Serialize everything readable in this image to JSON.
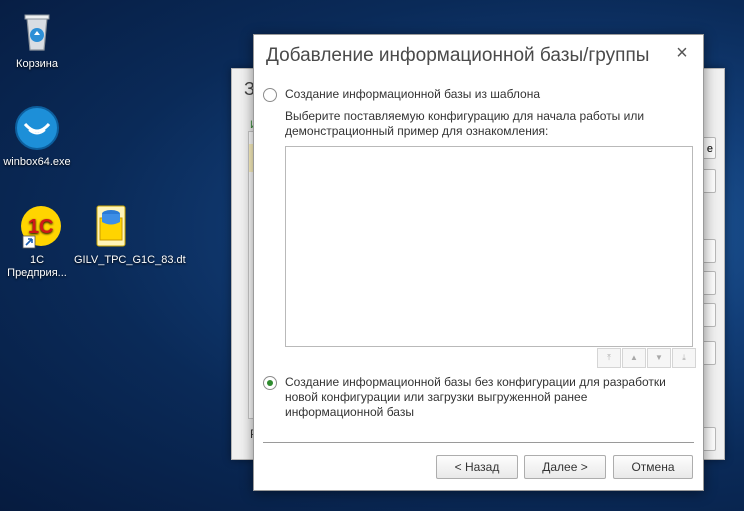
{
  "desktop": {
    "icons": [
      {
        "label": "Корзина"
      },
      {
        "label": "winbox64.exe"
      },
      {
        "label": "1C Предприя..."
      },
      {
        "label": "GILV_TPC_G1C_83.dt"
      }
    ]
  },
  "background_window": {
    "title_fragment": "З",
    "green_fragment": "И",
    "bottom_fragment": "Р",
    "button_fragment": "е"
  },
  "dialog": {
    "title": "Добавление информационной базы/группы",
    "close_symbol": "×",
    "option_template": "Создание информационной базы из шаблона",
    "hint": "Выберите поставляемую конфигурацию для начала работы или демонстрационный пример для ознакомления:",
    "option_empty": "Создание информационной базы без конфигурации для разработки новой конфигурации или загрузки выгруженной ранее информационной базы",
    "selected_option": "empty",
    "buttons": {
      "back": "< Назад",
      "next": "Далее >",
      "cancel": "Отмена"
    }
  },
  "colors": {
    "radio_checked": "#2e8b2e",
    "desktop_blue": "#123e78"
  }
}
